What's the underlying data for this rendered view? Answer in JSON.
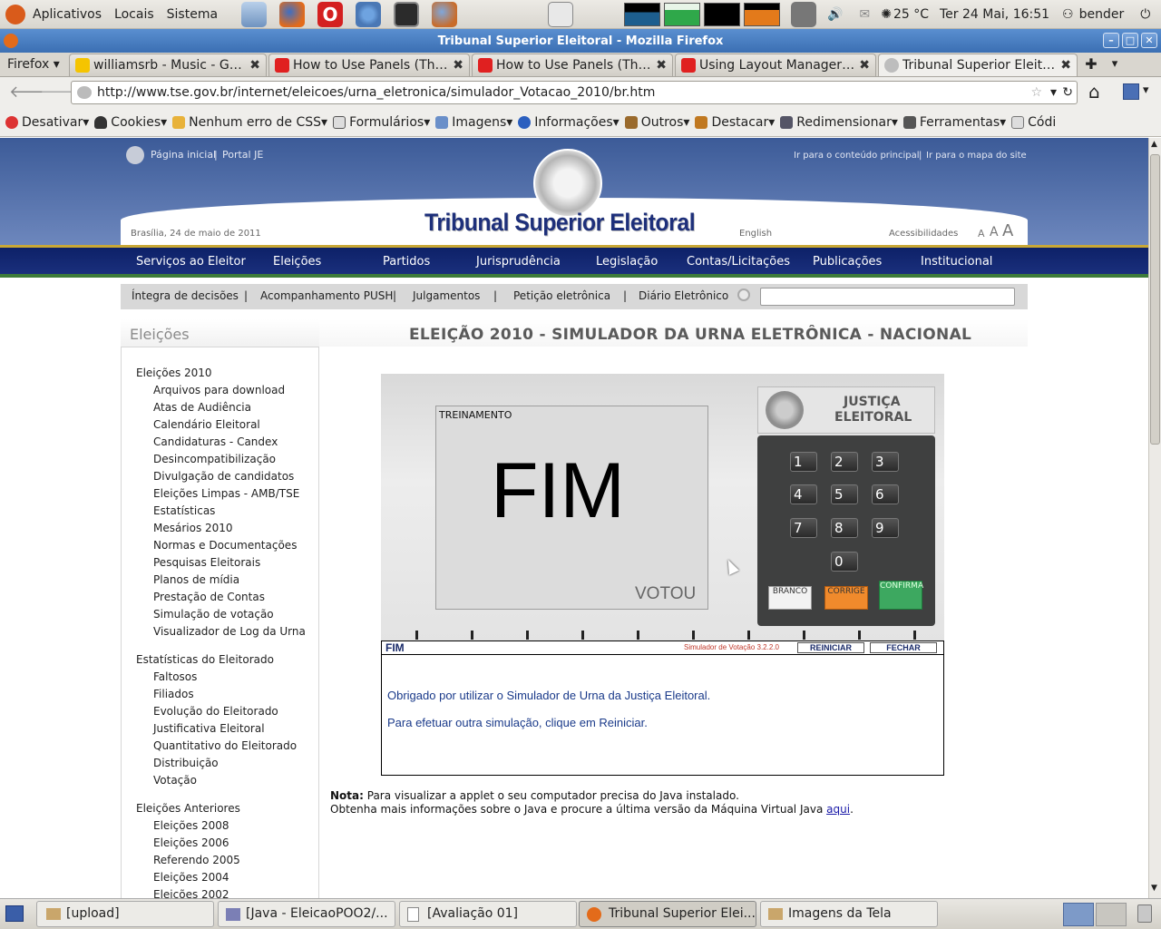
{
  "panel": {
    "menu": [
      "Aplicativos",
      "Locais",
      "Sistema"
    ],
    "weather": "25 °C",
    "clock": "Ter 24 Mai, 16:51",
    "user": "bender"
  },
  "window": {
    "title": "Tribunal Superior Eleitoral - Mozilla Firefox"
  },
  "tabs": [
    {
      "label": "Firefox"
    },
    {
      "label": "williamsrb - Music - Gro..."
    },
    {
      "label": "How to Use Panels (The ..."
    },
    {
      "label": "How to Use Panels (The ..."
    },
    {
      "label": "Using Layout Managers..."
    },
    {
      "label": "Tribunal Superior Eleito..."
    }
  ],
  "nav": {
    "url": "http://www.tse.gov.br/internet/eleicoes/urna_eletronica/simulador_Votacao_2010/br.htm"
  },
  "webdev_toolbar": [
    "Desativar",
    "Cookies",
    "Nenhum erro de CSS",
    "Formulários",
    "Imagens",
    "Informações",
    "Outros",
    "Destacar",
    "Redimensionar",
    "Ferramentas",
    "Códi"
  ],
  "site": {
    "top_links_left": [
      "Página inicial",
      "Portal JE"
    ],
    "top_links_right": [
      "Ir para o conteúdo principal",
      "Ir para o mapa do site"
    ],
    "date": "Brasília, 24 de maio de 2011",
    "title": "Tribunal Superior Eleitoral",
    "english": "English",
    "acessibilidades": "Acessibilidades",
    "font_sizes": [
      "A",
      "A",
      "A"
    ],
    "main_nav": [
      "Serviços ao Eleitor",
      "Eleições",
      "Partidos",
      "Jurisprudência",
      "Legislação",
      "Contas/Licitações",
      "Publicações",
      "Institucional"
    ],
    "sub_nav": [
      "Íntegra de decisões",
      "Acompanhamento PUSH",
      "Julgamentos",
      "Petição eletrônica",
      "Diário Eletrônico"
    ]
  },
  "sidebar": {
    "title": "Eleições",
    "groups": [
      {
        "label": "Eleições 2010",
        "items": [
          "Arquivos para download",
          "Atas de Audiência",
          "Calendário Eleitoral",
          "Candidaturas - Candex",
          "Desincompatibilização",
          "Divulgação de candidatos",
          "Eleições Limpas - AMB/TSE",
          "Estatísticas",
          "Mesários 2010",
          "Normas e Documentações",
          "Pesquisas Eleitorais",
          "Planos de mídia",
          "Prestação de Contas",
          "Simulação de votação",
          "Visualizador de Log da Urna"
        ]
      },
      {
        "label": "Estatísticas do Eleitorado",
        "items": [
          "Faltosos",
          "Filiados",
          "Evolução do Eleitorado",
          "Justificativa Eleitoral",
          "Quantitativo do Eleitorado",
          "Distribuição",
          "Votação"
        ]
      },
      {
        "label": "Eleições Anteriores",
        "items": [
          "Eleições 2008",
          "Eleições 2006",
          "Referendo 2005",
          "Eleições 2004",
          "Eleições 2002"
        ]
      }
    ]
  },
  "main": {
    "heading": "ELEIÇÃO 2010 - SIMULADOR DA URNA ELETRÔNICA - NACIONAL",
    "urna": {
      "mode": "TREINAMENTO",
      "big_text": "FIM",
      "votou": "VOTOU",
      "brand_line1": "JUSTIÇA",
      "brand_line2": "ELEITORAL",
      "keys": [
        "1",
        "2",
        "3",
        "4",
        "5",
        "6",
        "7",
        "8",
        "9",
        "0"
      ],
      "branco": "BRANCO",
      "corrige": "CORRIGE",
      "confirma": "CONFIRMA"
    },
    "status_bar": {
      "state": "FIM",
      "version": "Simulador de Votação 3.2.2.0",
      "reiniciar": "REINICIAR",
      "fechar": "FECHAR"
    },
    "messages": [
      "Obrigado por utilizar o Simulador de Urna da Justiça Eleitoral.",
      "Para efetuar outra simulação, clique em Reiniciar."
    ],
    "note_label": "Nota:",
    "note_text": "Para visualizar a applet o seu computador precisa do Java instalado.",
    "note_line2": "Obtenha mais informações sobre o Java e procure a última versão da Máquina Virtual Java",
    "note_link": "aqui",
    "note_end": "."
  },
  "taskbar": [
    {
      "label": "[upload]"
    },
    {
      "label": "[Java - EleicaoPOO2/..."
    },
    {
      "label": "[Avaliação 01]"
    },
    {
      "label": "Tribunal Superior Elei..."
    },
    {
      "label": "Imagens da Tela"
    }
  ]
}
